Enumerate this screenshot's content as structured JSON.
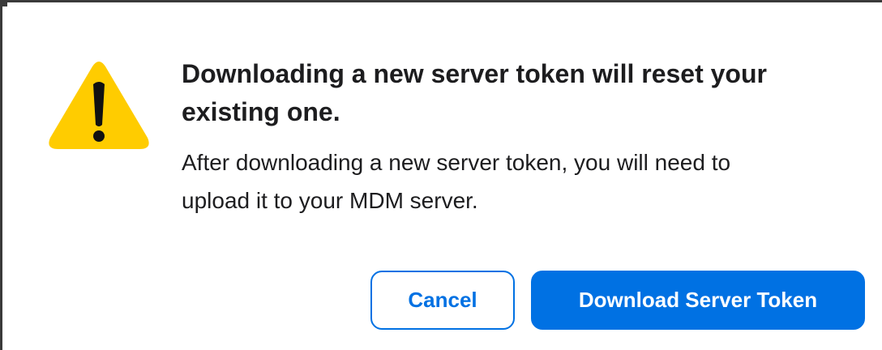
{
  "dialog": {
    "title": "Downloading a new server token will reset your existing one.",
    "message": "After downloading a new server token, you will need to upload it to your MDM server.",
    "icon": "warning-triangle-icon",
    "buttons": {
      "cancel_label": "Cancel",
      "primary_label": "Download Server Token"
    }
  },
  "colors": {
    "accent": "#0071e3",
    "warning": "#ffcc00",
    "text": "#1d1d1f"
  }
}
